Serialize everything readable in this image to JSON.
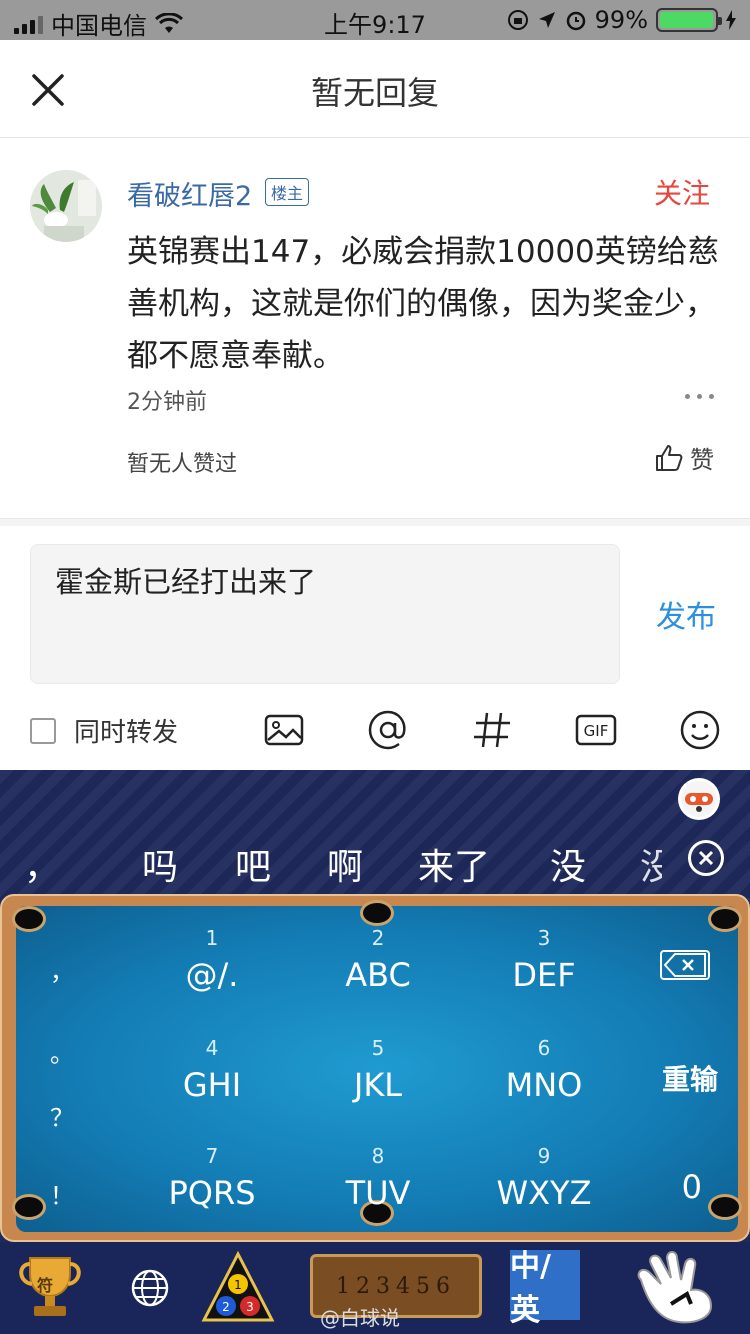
{
  "status_bar": {
    "carrier": "中国电信",
    "time": "上午9:17",
    "battery": "99%"
  },
  "header": {
    "title": "暂无回复"
  },
  "post": {
    "username": "看破红唇2",
    "badge": "楼主",
    "follow": "关注",
    "body": "英锦赛出147，必威会捐款10000英镑给慈善机构，这就是你们的偶像，因为奖金少，都不愿意奉献。",
    "time": "2分钟前",
    "likes_text": "暂无人赞过",
    "like_label": "赞"
  },
  "composer": {
    "input_value": "霍金斯已经打出来了",
    "publish": "发布",
    "repost_label": "同时转发"
  },
  "keyboard": {
    "candidates": [
      "，",
      "吗",
      "吧",
      "啊",
      "来了",
      "没",
      "没"
    ],
    "keys": [
      {
        "num": "1",
        "letters": "@/."
      },
      {
        "num": "2",
        "letters": "ABC"
      },
      {
        "num": "3",
        "letters": "DEF"
      },
      {
        "num": "4",
        "letters": "GHI"
      },
      {
        "num": "5",
        "letters": "JKL"
      },
      {
        "num": "6",
        "letters": "MNO"
      },
      {
        "num": "7",
        "letters": "PQRS"
      },
      {
        "num": "8",
        "letters": "TUV"
      },
      {
        "num": "9",
        "letters": "WXYZ"
      }
    ],
    "side_punct": [
      "，",
      "。",
      "？",
      "！"
    ],
    "reinput": "重输",
    "zero": "0",
    "counter_digits": "123456",
    "lang_toggle": "中/英",
    "trophy_char": "符",
    "watermark": "@白球说"
  }
}
